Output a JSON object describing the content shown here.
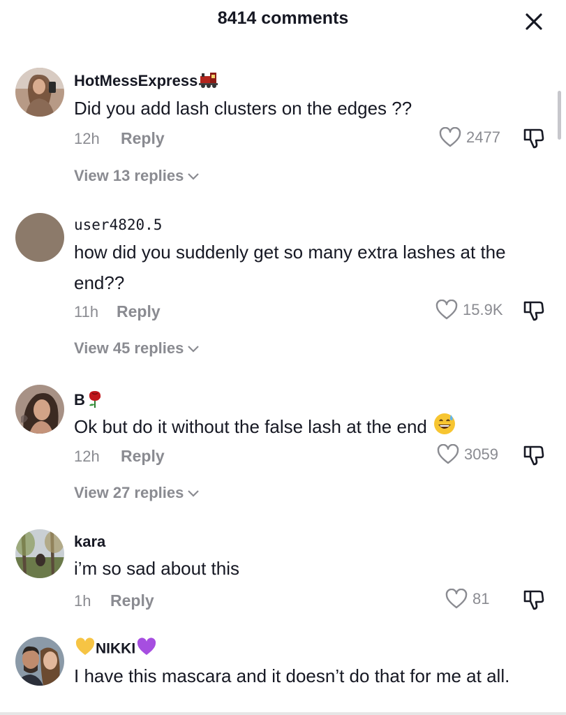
{
  "header": {
    "title": "8414 comments"
  },
  "comments": [
    {
      "username": "HotMessExpress",
      "username_emoji": "train-icon",
      "text": "Did you add lash clusters on the edges ??",
      "time": "12h",
      "reply_label": "Reply",
      "likes": "2477",
      "view_replies": "View 13 replies"
    },
    {
      "username": "user4820.5",
      "text": "how did you suddenly get so many extra lashes at the end??",
      "time": "11h",
      "reply_label": "Reply",
      "likes": "15.9K",
      "view_replies": "View 45 replies"
    },
    {
      "username": "B",
      "username_emoji": "rose-icon",
      "text": "Ok but do it without the false lash at the end",
      "text_emoji": "grinning-sweat-icon",
      "time": "12h",
      "reply_label": "Reply",
      "likes": "3059",
      "view_replies": "View 27 replies"
    },
    {
      "username": "kara",
      "text": "i’m so sad about this",
      "time": "1h",
      "reply_label": "Reply",
      "likes": "81"
    },
    {
      "username": "NIKKI",
      "username_prefix_emoji": "yellow-heart-icon",
      "username_emoji": "purple-heart-icon",
      "text": "I have this mascara and it doesn’t do that for me at all."
    }
  ],
  "colors": {
    "text_primary": "#161823",
    "text_secondary": "#8a8b91",
    "background": "#ffffff",
    "avatar_placeholder": "#8c7a6a"
  }
}
